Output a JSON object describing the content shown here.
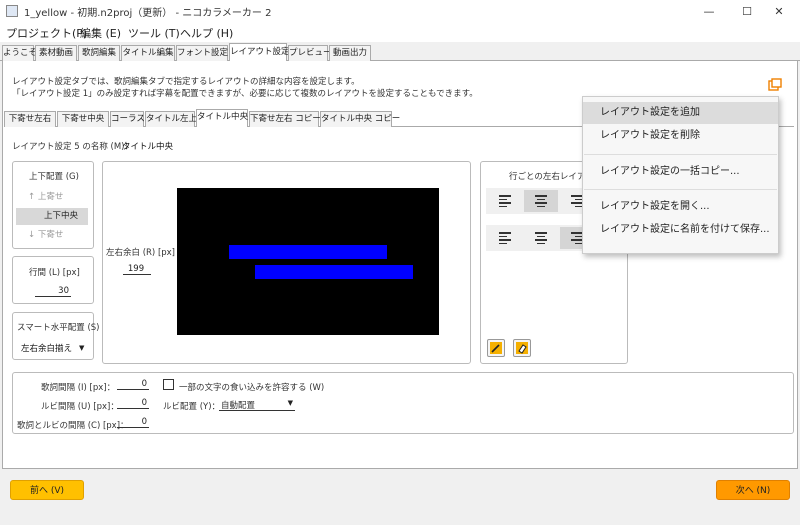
{
  "window": {
    "title": "1_yellow - 初期.n2proj（更新） - ニコカラメーカー 2",
    "minimize": "—",
    "maximize": "☐",
    "close": "✕"
  },
  "menu": [
    "プロジェクト(P)",
    "編集 (E)",
    "ツール (T)",
    "ヘルプ (H)"
  ],
  "main_tabs": [
    "ようこそ",
    "素材動画",
    "歌詞編集",
    "タイトル編集",
    "フォント設定",
    "レイアウト設定",
    "プレビュー",
    "動画出力"
  ],
  "active_main_tab": "レイアウト設定",
  "description": [
    "レイアウト設定タブでは、歌詞編集タブで指定するレイアウトの詳細な内容を設定します。",
    "「レイアウト設定 1」のみ設定すれば字幕を配置できますが、必要に応じて複数のレイアウトを設定することもできます。"
  ],
  "layout_tabs": [
    "下寄せ左右",
    "下寄せ中央",
    "コーラス",
    "タイトル左上",
    "タイトル中央",
    "下寄せ左右 コピー",
    "タイトル中央 コピー"
  ],
  "active_layout_tab": "タイトル中央",
  "layout_name": {
    "label": "レイアウト設定 5 の名称 (M)：",
    "value": "タイトル中央"
  },
  "vertical": {
    "label": "上下配置 (G)",
    "items": [
      "↑ 上寄せ",
      "上下中央",
      "↓ 下寄せ"
    ],
    "selected": "上下中央"
  },
  "line_spacing": {
    "label": "行間 (L) [px]",
    "value": "30"
  },
  "smart_h": {
    "label": "スマート水平配置 (S)",
    "value": "左右余白揃え"
  },
  "margin": {
    "label": "左右余白 (R) [px]",
    "value": "199"
  },
  "line_align": {
    "label": "行ごとの左右レイアウト"
  },
  "lyric_gap": {
    "label": "歌詞間隔 (I) [px]：",
    "value": "0"
  },
  "ruby_gap": {
    "label": "ルビ間隔 (U) [px]：",
    "value": "0"
  },
  "lyric_ruby_gap": {
    "label": "歌詞とルビの間隔 (C) [px]：",
    "value": "0"
  },
  "allow_overlap": {
    "label": "一部の文字の食い込みを許容する (W)"
  },
  "ruby_place": {
    "label": "ルビ配置 (Y)：",
    "value": "自動配置"
  },
  "buttons": {
    "prev": "前へ (V)",
    "next": "次へ (N)"
  },
  "popup_menu": [
    "レイアウト設定を追加",
    "レイアウト設定を削除",
    "レイアウト設定の一括コピー...",
    "レイアウト設定を開く...",
    "レイアウト設定に名前を付けて保存..."
  ],
  "colors": {
    "accent": "#ffa000",
    "preview_bg": "#000000",
    "preview_bar": "#0000ff"
  }
}
